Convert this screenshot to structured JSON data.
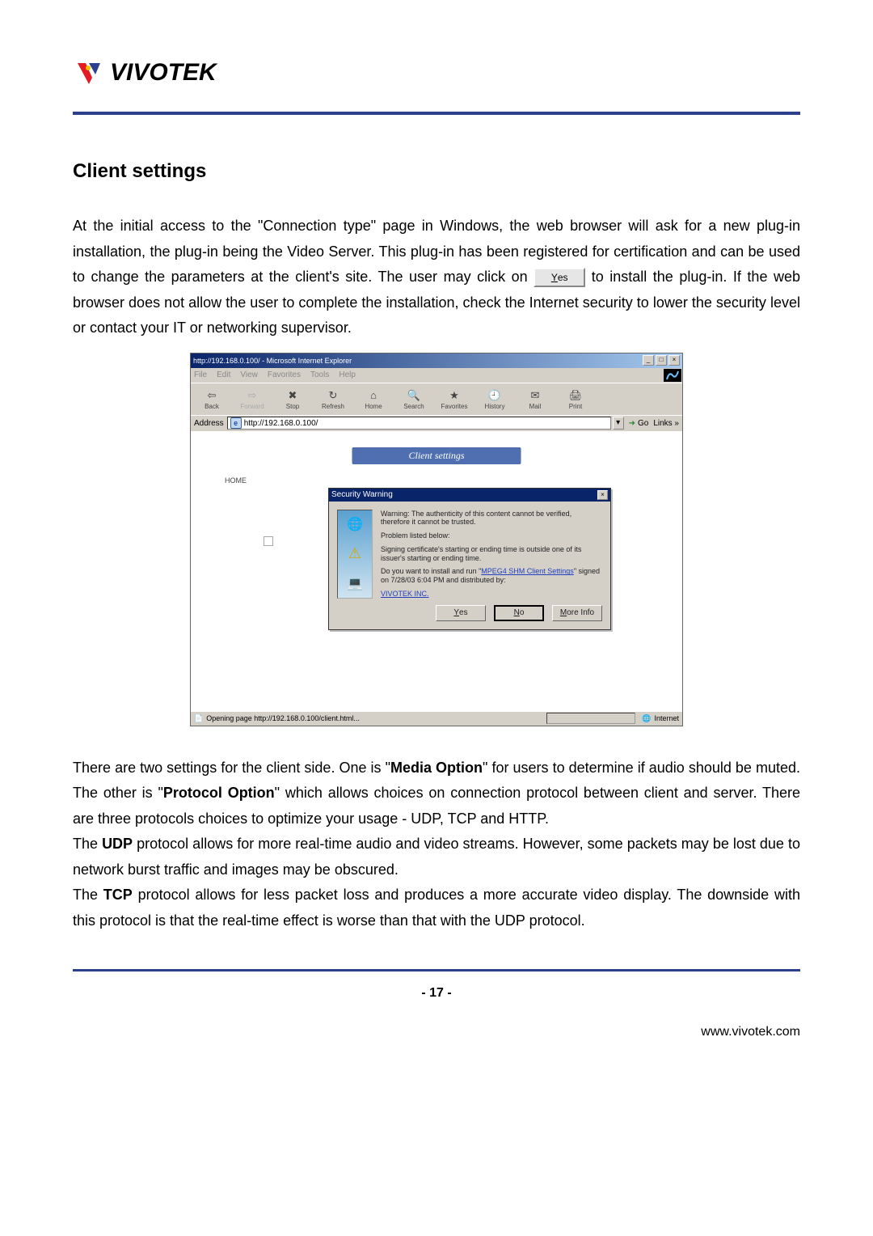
{
  "logo_text": "VIVOTEK",
  "section_title": "Client settings",
  "paragraph1_pre": "At the initial access to the \"Connection type\" page in Windows, the web browser will ask for a new plug-in installation, the plug-in being the Video Server. This plug-in has been registered for certification and can be used to change the parameters at the client's site. The user may click on ",
  "yes_label": "Yes",
  "paragraph1_post": " to install the plug-in. If the web browser does not allow the user to complete the installation, check the Internet security to lower the security level or contact your IT or networking supervisor.",
  "ie": {
    "title": "http://192.168.0.100/ - Microsoft Internet Explorer",
    "menus": [
      "File",
      "Edit",
      "View",
      "Favorites",
      "Tools",
      "Help"
    ],
    "toolbar": [
      "Back",
      "Forward",
      "Stop",
      "Refresh",
      "Home",
      "Search",
      "Favorites",
      "History",
      "Mail",
      "Print"
    ],
    "address_label": "Address",
    "address_value": "http://192.168.0.100/",
    "go": "Go",
    "links": "Links »",
    "banner": "Client settings",
    "home": "HOME",
    "status_left": "Opening page http://192.168.0.100/client.html...",
    "status_right": "Internet"
  },
  "dialog": {
    "title": "Security Warning",
    "warning": "Warning: The authenticity of this content cannot be verified, therefore it cannot be trusted.",
    "problem": "Problem listed below:",
    "cert": "Signing certificate's starting or ending time is outside one of its issuer's starting or ending time.",
    "install_pre": "Do you want to install and run \"",
    "install_link": "MPEG4 SHM Client Settings",
    "install_post": "\" signed on 7/28/03 6:04 PM and distributed by:",
    "vendor": "VIVOTEK INC.",
    "btn_yes": "Yes",
    "btn_no": "No",
    "btn_more": "More Info"
  },
  "para2_a": "There are two settings for the client side. One is \"",
  "para2_media": "Media Option",
  "para2_b": "\" for users to determine if audio should be muted. The other is \"",
  "para2_proto": "Protocol Option",
  "para2_c": "\" which allows choices on connection protocol between client and server. There are three protocols choices to optimize your usage - UDP, TCP and HTTP.",
  "para3_pre": "The ",
  "para3_udp": "UDP",
  "para3_post": " protocol allows for more real-time audio and video streams. However, some packets may be lost due to network burst traffic and images may be obscured.",
  "para4_pre": "The ",
  "para4_tcp": "TCP",
  "para4_post": " protocol allows for less packet loss and produces a more accurate video display. The downside with this protocol is that the real-time effect is worse than that with the UDP protocol.",
  "page_number": "- 17 -",
  "footer_url": "www.vivotek.com"
}
